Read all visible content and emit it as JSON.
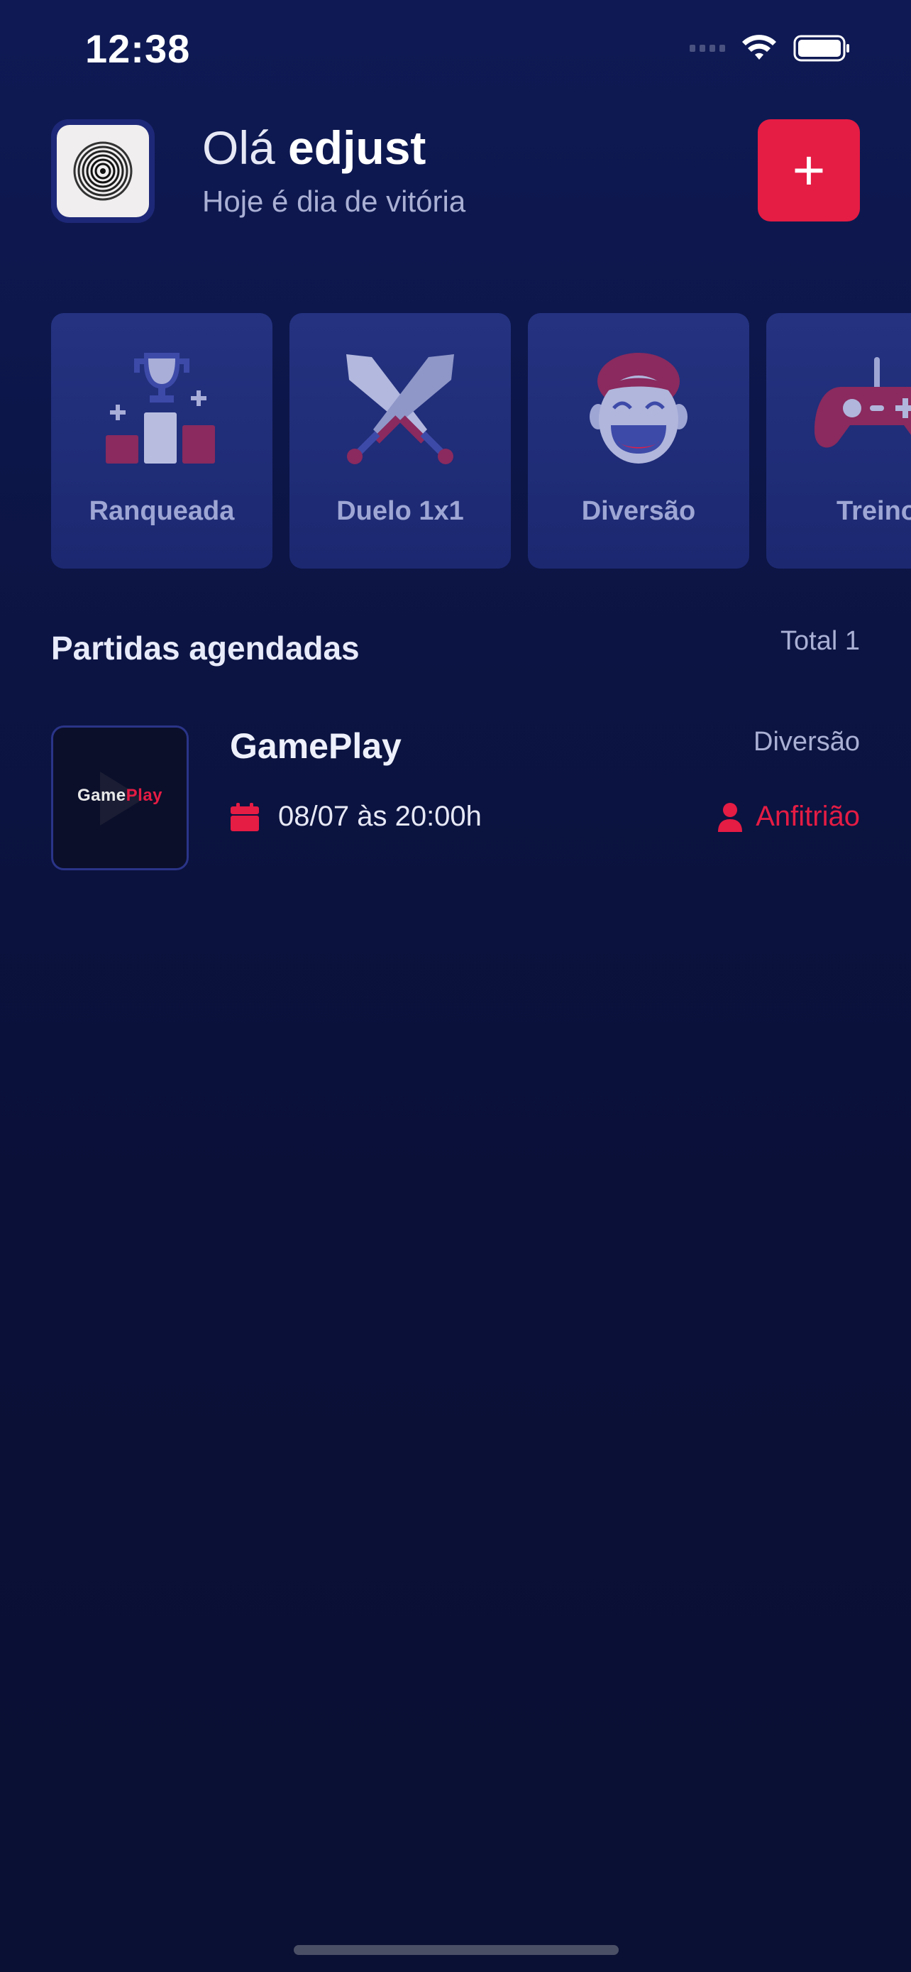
{
  "status_bar": {
    "time": "12:38"
  },
  "header": {
    "greeting_prefix": "Olá ",
    "username": "edjust",
    "subtitle": "Hoje é dia de vitória",
    "add_button_label": "+"
  },
  "categories": [
    {
      "label": "Ranqueada",
      "icon": "trophy-podium-icon"
    },
    {
      "label": "Duelo 1x1",
      "icon": "crossed-swords-icon"
    },
    {
      "label": "Diversão",
      "icon": "laughing-face-icon"
    },
    {
      "label": "Treino",
      "icon": "gamepad-icon"
    }
  ],
  "scheduled": {
    "title": "Partidas agendadas",
    "total_label": "Total 1",
    "matches": [
      {
        "title": "GamePlay",
        "thumbnail_text_a": "Game",
        "thumbnail_text_b": "Play",
        "category": "Diversão",
        "datetime": "08/07 às 20:00h",
        "role": "Anfitrião"
      }
    ]
  },
  "colors": {
    "accent": "#e51c44",
    "background": "#0a1033",
    "card": "#243280",
    "muted_text": "#aab0d4"
  }
}
